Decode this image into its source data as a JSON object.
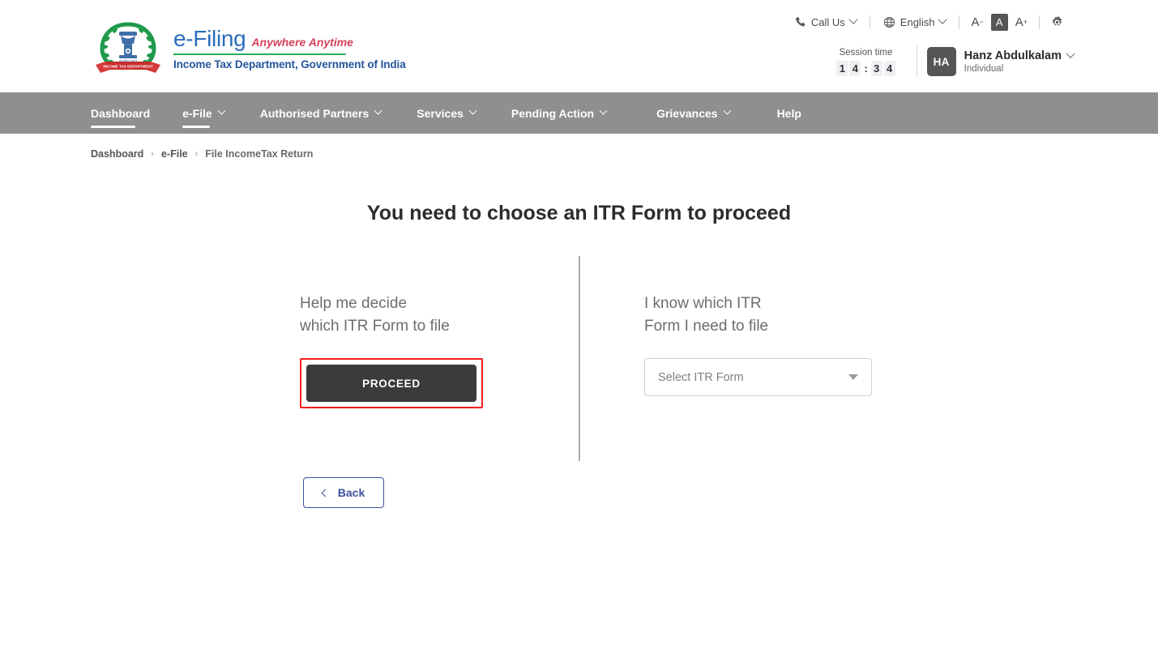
{
  "header": {
    "logo": {
      "brand": "e-Filing",
      "tagline": "Anywhere Anytime",
      "department": "Income Tax Department, Government of India",
      "emblem_alt": "income-tax-department-emblem"
    },
    "utility": {
      "call_us": "Call Us",
      "language": "English",
      "font_decrease": "A",
      "font_normal": "A",
      "font_increase": "A",
      "settings": "settings"
    },
    "session": {
      "label": "Session time",
      "minutes": [
        "1",
        "4"
      ],
      "separator": ":",
      "seconds": [
        "3",
        "4"
      ]
    },
    "user": {
      "initials": "HA",
      "name": "Hanz Abdulkalam",
      "role": "Individual"
    }
  },
  "nav": {
    "items": [
      {
        "label": "Dashboard",
        "has_caret": false,
        "active": false
      },
      {
        "label": "e-File",
        "has_caret": true,
        "active": true
      },
      {
        "label": "Authorised Partners",
        "has_caret": true,
        "active": false
      },
      {
        "label": "Services",
        "has_caret": true,
        "active": false
      },
      {
        "label": "Pending Action",
        "has_caret": true,
        "active": false
      },
      {
        "label": "Grievances",
        "has_caret": true,
        "active": false
      },
      {
        "label": "Help",
        "has_caret": false,
        "active": false
      }
    ]
  },
  "breadcrumb": {
    "items": [
      "Dashboard",
      "e-File",
      "File IncomeTax Return"
    ],
    "separator": "›"
  },
  "main": {
    "title": "You need to choose an ITR Form to proceed",
    "left": {
      "label": "Help me decide\nwhich ITR Form to file",
      "proceed_label": "PROCEED"
    },
    "right": {
      "label": "I know which ITR\nForm I need to file",
      "select_placeholder": "Select ITR Form"
    },
    "back_label": "Back"
  },
  "colors": {
    "nav_bg": "#8f8f8f",
    "brand_blue": "#2a6ebb",
    "brand_red": "#d6435b",
    "brand_green": "#2bab5a",
    "dept_blue": "#23569c",
    "proceed_bg": "#3b3b3b",
    "highlight_red": "#f21d1d",
    "back_blue": "#3f51a0"
  }
}
